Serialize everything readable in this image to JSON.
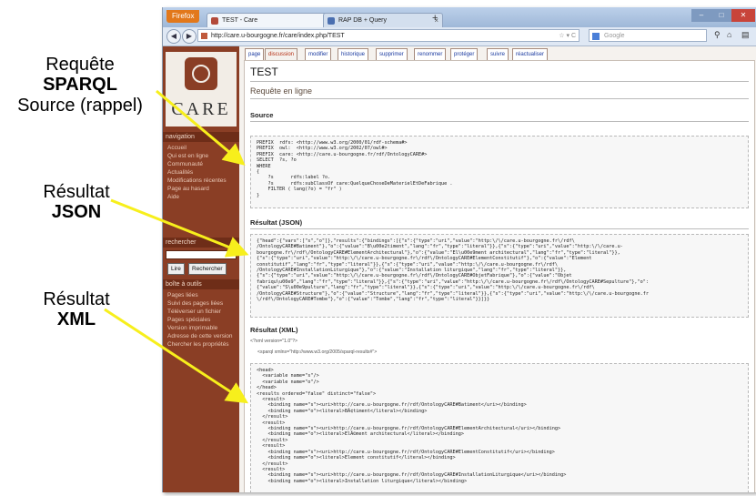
{
  "annotations": {
    "sparql": {
      "line1": "Requête",
      "line2": "SPARQL",
      "line3": "Source (rappel)"
    },
    "json": {
      "line1": "Résultat",
      "line2": "JSON"
    },
    "xml": {
      "line1": "Résultat",
      "line2": "XML"
    },
    "arrow_color": "#f7ef1c"
  },
  "browser": {
    "app_button": "Firefox",
    "tabs": [
      {
        "title": "TEST - Care"
      },
      {
        "title": "RAP DB + Query"
      }
    ],
    "new_tab": "+",
    "url": "http://care.u-bourgogne.fr/care/index.php/TEST",
    "search_placeholder": "Google",
    "icons": [
      "back-icon",
      "forward-icon",
      "refresh-icon",
      "home-icon",
      "bookmark-icon"
    ]
  },
  "sidebar": {
    "logo_text": "CARE",
    "nav_heading": "navigation",
    "nav_items": [
      "Accueil",
      "Qui est en ligne",
      "Communauté",
      "Actualités",
      "Modifications récentes",
      "Page au hasard",
      "Aide"
    ],
    "search_heading": "rechercher",
    "go_button": "Lire",
    "search_button": "Rechercher",
    "tools_heading": "boîte à outils",
    "tools_items": [
      "Pages liées",
      "Suivi des pages liées",
      "Téléverser un fichier",
      "Pages spéciales",
      "Version imprimable",
      "Adresse de cette version",
      "Chercher les propriétés"
    ]
  },
  "page_tabs": [
    "page",
    "discussion",
    "modifier",
    "historique",
    "supprimer",
    "renommer",
    "protéger",
    "suivre",
    "réactualiser"
  ],
  "page": {
    "title": "TEST",
    "subtitle": "Requête en ligne",
    "source_heading": "Source",
    "source_code": "PREFIX  rdfs: <http://www.w3.org/2000/01/rdf-schema#>\nPREFIX  owl:  <http://www.w3.org/2002/07/owl#>\nPREFIX  care: <http://care.u-bourgogne.fr/rdf/OntologyCARE#>\nSELECT  ?s, ?o\nWHERE\n{\n    ?s      rdfs:label ?o.\n    ?s      rdfs:subClassOf care:QuelqueChoseDeMaterielEtDeFabrique .\n    FILTER ( lang(?o) = \"fr\" )\n}",
    "json_heading": "Résultat (JSON)",
    "json_code": "{\"head\":{\"vars\":[\"s\",\"o\"]},\"results\":{\"bindings\":[{\"s\":{\"type\":\"uri\",\"value\":\"http:\\/\\/care.u-bourgogne.fr\\/rdf\\\n/OntologyCARE#Batiment\"},\"o\":{\"value\":\"B\\u00e2timent\",\"lang\":\"fr\",\"type\":\"literal\"}},{\"s\":{\"type\":\"uri\",\"value\":\"http:\\/\\/care.u-\nbourgogne.fr\\/rdf\\/OntologyCARE#ElementArchitectural\"},\"o\":{\"value\":\"El\\u00e9ment architectural\",\"lang\":\"fr\",\"type\":\"literal\"}},\n{\"s\":{\"type\":\"uri\",\"value\":\"http:\\/\\/care.u-bourgogne.fr\\/rdf\\/OntologyCARE#ElementConstitutif\"},\"o\":{\"value\":\"Element\nconstitutif\",\"lang\":\"fr\",\"type\":\"literal\"}},{\"s\":{\"type\":\"uri\",\"value\":\"http:\\/\\/care.u-bourgogne.fr\\/rdf\\\n/OntologyCARE#InstallationLiturgique\"},\"o\":{\"value\":\"Installation liturgique\",\"lang\":\"fr\",\"type\":\"literal\"}},\n{\"s\":{\"type\":\"uri\",\"value\":\"http:\\/\\/care.u-bourgogne.fr\\/rdf\\/OntologyCARE#ObjetFabrique\"},\"o\":{\"value\":\"Objet\nfabriqu\\u00e9\",\"lang\":\"fr\",\"type\":\"literal\"}},{\"s\":{\"type\":\"uri\",\"value\":\"http:\\/\\/care.u-bourgogne.fr\\/rdf\\/OntologyCARE#Sepulture\"},\"o\":\n{\"value\":\"S\\u00e9pulture\",\"lang\":\"fr\",\"type\":\"literal\"}},{\"s\":{\"type\":\"uri\",\"value\":\"http:\\/\\/care.u-bourgogne.fr\\/rdf\\\n/OntologyCARE#Structure\"},\"o\":{\"value\":\"Structure\",\"lang\":\"fr\",\"type\":\"literal\"}},{\"s\":{\"type\":\"uri\",\"value\":\"http:\\/\\/care.u-bourgogne.fr\n\\/rdf\\/OntologyCARE#Tombe\"},\"o\":{\"value\":\"Tombe\",\"lang\":\"fr\",\"type\":\"literal\"}}]}}",
    "xml_heading": "Résultat (XML)",
    "xml_decl": "<?xml version=\"1.0\"?>",
    "xml_root": "<sparql xmlns=\"http://www.w3.org/2005/sparql-results#\">",
    "xml_code": "<head>\n  <variable name=\"s\"/>\n  <variable name=\"o\"/>\n</head>\n<results ordered=\"false\" distinct=\"false\">\n  <result>\n    <binding name=\"s\"><uri>http://care.u-bourgogne.fr/rdf/OntologyCARE#Batiment</uri></binding>\n    <binding name=\"o\"><literal>BÃ¢timent</literal></binding>\n  </result>\n  <result>\n    <binding name=\"s\"><uri>http://care.u-bourgogne.fr/rdf/OntologyCARE#ElementArchitectural</uri></binding>\n    <binding name=\"o\"><literal>ElÃ©ment architectural</literal></binding>\n  </result>\n  <result>\n    <binding name=\"s\"><uri>http://care.u-bourgogne.fr/rdf/OntologyCARE#ElementConstitutif</uri></binding>\n    <binding name=\"o\"><literal>Element constitutif</literal></binding>\n  </result>\n  <result>\n    <binding name=\"s\"><uri>http://care.u-bourgogne.fr/rdf/OntologyCARE#InstallationLiturgique</uri></binding>\n    <binding name=\"o\"><literal>Installation liturgique</literal></binding>"
  }
}
